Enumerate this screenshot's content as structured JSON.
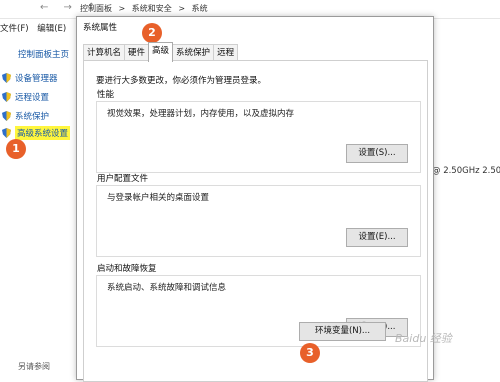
{
  "nav": {
    "back_arrows": "← → ↑",
    "breadcrumb": [
      "控制面板",
      ">",
      "系统和安全",
      ">",
      "系统"
    ]
  },
  "menubar": {
    "file": "文件(F)",
    "edit": "编辑(E)"
  },
  "left_pane": {
    "home": "控制面板主页",
    "items": [
      {
        "label": "设备管理器"
      },
      {
        "label": "远程设置"
      },
      {
        "label": "系统保护"
      },
      {
        "label": "高级系统设置"
      }
    ],
    "see_also": "另请参阅"
  },
  "right_info": "@ 2.50GHz  2.50",
  "dialog": {
    "title": "系统属性",
    "tabs": [
      "计算机名",
      "硬件",
      "高级",
      "系统保护",
      "远程"
    ],
    "active_tab": "高级",
    "intro": "要进行大多数更改，你必须作为管理员登录。",
    "groups": [
      {
        "title": "性能",
        "desc": "视觉效果，处理器计划，内存使用，以及虚拟内存",
        "button": "设置(S)..."
      },
      {
        "title": "用户配置文件",
        "desc": "与登录帐户相关的桌面设置",
        "button": "设置(E)..."
      },
      {
        "title": "启动和故障恢复",
        "desc": "系统启动、系统故障和调试信息",
        "button": "设置(T)..."
      }
    ],
    "env_button": "环境变量(N)..."
  },
  "markers": [
    "1",
    "2",
    "3"
  ],
  "watermark": "Baidu 经验",
  "colors": {
    "marker": "#e8602a",
    "highlight": "#fff63d",
    "link": "#1a5aa6"
  }
}
